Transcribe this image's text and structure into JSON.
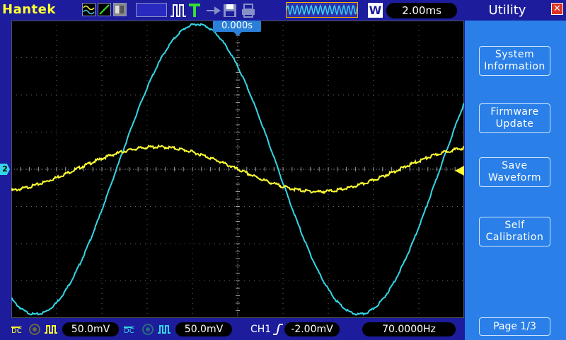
{
  "header": {
    "brand": "Hantek",
    "timebase": "2.00ms",
    "acquire_mode": "W"
  },
  "screen": {
    "trigger_time": "0.000s",
    "channel_marker": "2"
  },
  "sidebar": {
    "title": "Utility",
    "close_glyph": "✕",
    "items": [
      {
        "label": "System\nInformation"
      },
      {
        "label": "Firmware\nUpdate"
      },
      {
        "label": "Save\nWaveform"
      },
      {
        "label": "Self\nCalibration"
      }
    ],
    "page": "Page 1/3"
  },
  "footer": {
    "ch1_coupling": "DC",
    "ch1_scale": "50.0mV",
    "ch2_coupling": "DC",
    "ch2_scale": "50.0mV",
    "trigger_source": "CH1",
    "trigger_level": "-2.00mV",
    "frequency": "70.0000Hz"
  },
  "colors": {
    "ch1": "#ffff33",
    "ch2": "#33d6e6",
    "background": "#1c1c9c",
    "sidebar": "#2a80e8"
  },
  "waveforms": {
    "ch1": {
      "frequency_hz": 70,
      "amplitude_div": 0.6,
      "offset_div": 0,
      "phase_deg": 180
    },
    "ch2": {
      "frequency_hz": 70,
      "amplitude_div": 3.9,
      "offset_div": 0,
      "phase_deg": 135
    }
  }
}
